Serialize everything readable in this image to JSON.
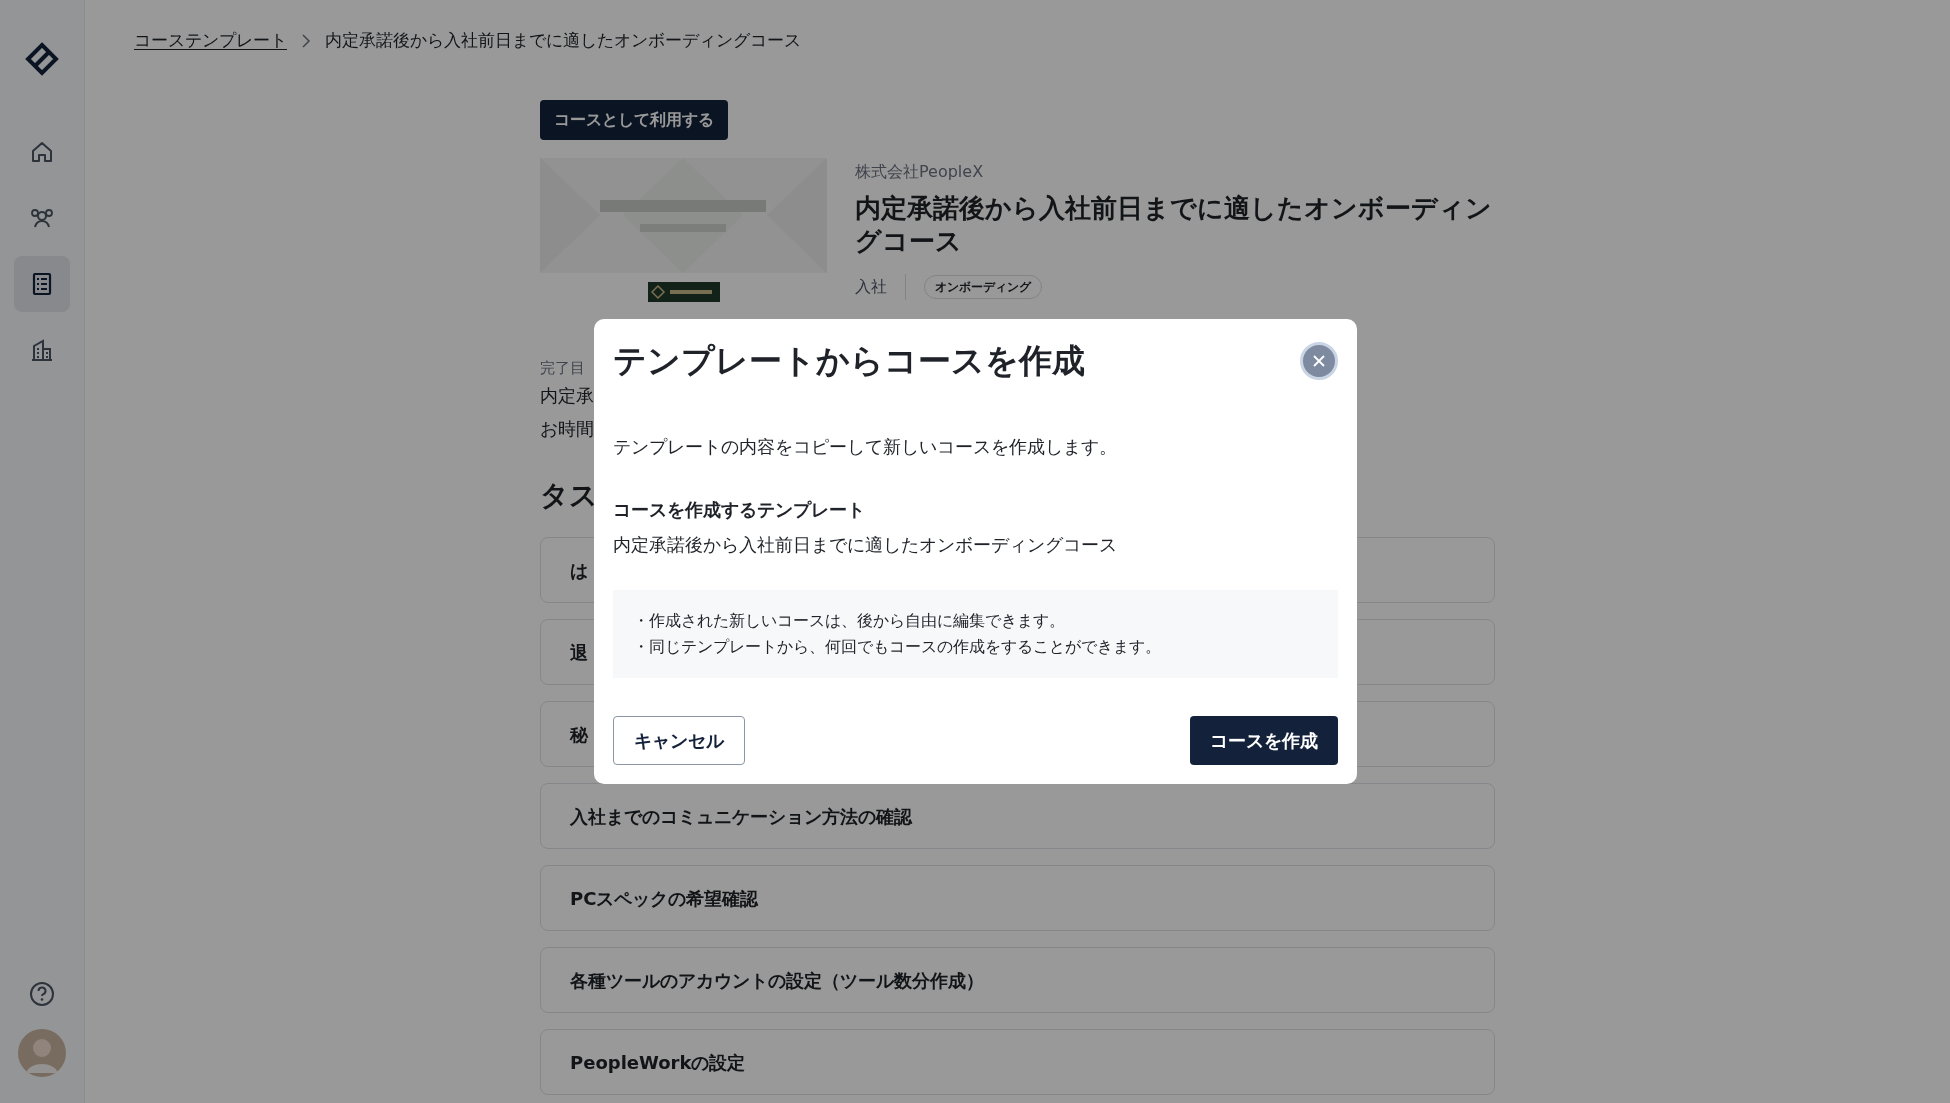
{
  "sidebar": {
    "nav_items": [
      {
        "kind": "home",
        "selected": false
      },
      {
        "kind": "people",
        "selected": false
      },
      {
        "kind": "course",
        "selected": true
      },
      {
        "kind": "building",
        "selected": false
      }
    ]
  },
  "breadcrumb": [
    {
      "label": "コーステンプレート",
      "kind": "link"
    },
    {
      "label": "内定承諾後から入社前日までに適したオンボーディングコース",
      "kind": "current"
    }
  ],
  "template": {
    "use_button": "コースとして利用する",
    "thumbnail": {
      "kind": "picture"
    },
    "company": "株式会社PeopleX",
    "title": "内定承諾後から入社前日までに適したオンボーディングコース",
    "category": "入社",
    "tags": [
      "オンボーディング"
    ]
  },
  "description": {
    "label": "完了目",
    "lines": [
      "内定承",
      "お時間"
    ]
  },
  "tasks": {
    "heading": "タス",
    "items": [
      "は",
      "退",
      "秘",
      "入社までのコミュニケーション方法の確認",
      "PCスペックの希望確認",
      "各種ツールのアカウントの設定（ツール数分作成）",
      "PeopleWorkの設定"
    ]
  },
  "modal": {
    "title": "テンプレートからコースを作成",
    "intro": "テンプレートの内容をコピーして新しいコースを作成します。",
    "template_label": "コースを作成するテンプレート",
    "template_name": "内定承諾後から入社前日までに適したオンボーディングコース",
    "notes": [
      "・作成された新しいコースは、後から自由に編集できます。",
      "・同じテンプレートから、何回でもコースの作成をすることができます。"
    ],
    "cancel_button": "キャンセル",
    "create_button": "コースを作成"
  }
}
